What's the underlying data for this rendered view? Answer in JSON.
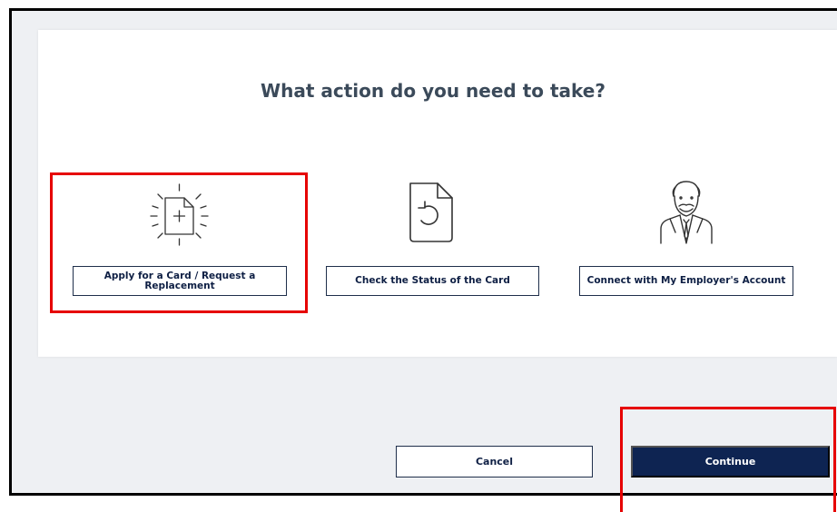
{
  "dialog": {
    "title": "What action do you need to take?"
  },
  "options": [
    {
      "label": "Apply for a Card / Request a Replacement",
      "icon": "new-document-icon"
    },
    {
      "label": "Check the Status of the Card",
      "icon": "document-refresh-icon"
    },
    {
      "label": "Connect with My Employer's Account",
      "icon": "businessman-icon"
    }
  ],
  "footer": {
    "cancel_label": "Cancel",
    "continue_label": "Continue"
  },
  "colors": {
    "primary": "#0e2452",
    "highlight": "#e60000",
    "title": "#3b4a5a"
  }
}
